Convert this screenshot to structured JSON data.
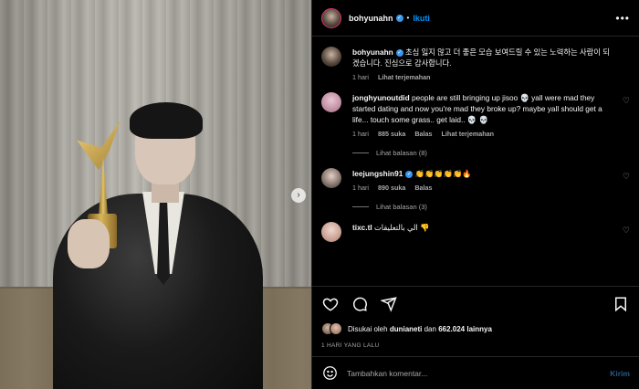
{
  "header": {
    "username": "bohyunahn",
    "follow_label": "Ikuti",
    "more_icon": "more-dots-icon"
  },
  "caption": {
    "username": "bohyunahn",
    "text": "초심 잃지 않고 더 좋은 모습 보여드릴 수 있는 노력하는 사람이 되겠습니다. 진심으로 감사합니다.",
    "time": "1 hari",
    "translate": "Lihat terjemahan"
  },
  "comments": [
    {
      "username": "jonghyunoutdid",
      "text": "people are still bringing up jisoo 💀 yall were mad they started dating and now you're mad they broke up? maybe yall should get a life... touch some grass.. get laid.. 💀 💀",
      "time": "1 hari",
      "likes": "885 suka",
      "reply": "Balas",
      "translate": "Lihat terjemahan",
      "replies": "Lihat balasan (8)"
    },
    {
      "username": "leejungshin91",
      "text": "👏👏👏👏👏🔥",
      "time": "1 hari",
      "likes": "890 suka",
      "reply": "Balas",
      "replies": "Lihat balasan (3)"
    },
    {
      "username": "tixc.tl",
      "text": "الي بالتعليقات 👎"
    }
  ],
  "likes_line": {
    "prefix": "Disukai oleh",
    "user": "dunianeti",
    "middle": "dan",
    "count": "662.024 lainnya"
  },
  "date": "1 HARI YANG LALU",
  "add_comment": {
    "placeholder": "Tambahkan komentar...",
    "post_label": "Kirim"
  },
  "colors": {
    "accent": "#0095f6",
    "verified": "#3897f0",
    "background": "#000000",
    "muted_text": "#a8a8a8"
  }
}
